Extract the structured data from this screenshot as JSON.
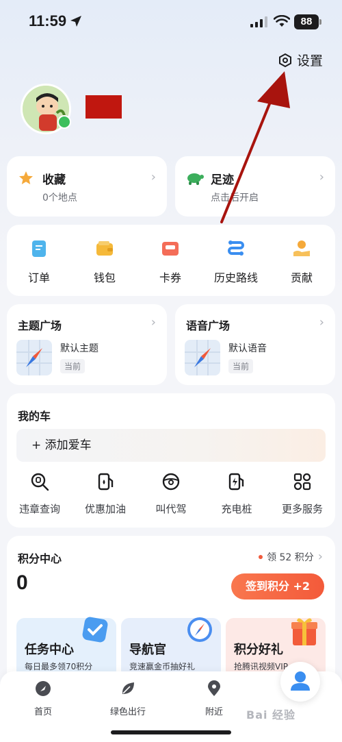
{
  "status": {
    "time": "11:59",
    "battery": "88"
  },
  "header": {
    "settings_label": "设置"
  },
  "favorites": {
    "title": "收藏",
    "subtitle": "0个地点"
  },
  "footprints": {
    "title": "足迹",
    "subtitle": "点击后开启"
  },
  "tools": [
    {
      "label": "订单",
      "icon": "order-icon"
    },
    {
      "label": "钱包",
      "icon": "wallet-icon"
    },
    {
      "label": "卡券",
      "icon": "coupon-icon"
    },
    {
      "label": "历史路线",
      "icon": "route-history-icon"
    },
    {
      "label": "贡献",
      "icon": "contribute-icon"
    }
  ],
  "theme_square": {
    "title": "主题广场",
    "name": "默认主题",
    "tag": "当前"
  },
  "voice_square": {
    "title": "语音广场",
    "name": "默认语音",
    "tag": "当前"
  },
  "my_car": {
    "title": "我的车",
    "add_label": "+ 添加爱车",
    "services": [
      {
        "label": "违章查询",
        "icon": "violation-search-icon"
      },
      {
        "label": "优惠加油",
        "icon": "fuel-icon"
      },
      {
        "label": "叫代驾",
        "icon": "steering-wheel-icon"
      },
      {
        "label": "充电桩",
        "icon": "charging-pile-icon"
      },
      {
        "label": "更多服务",
        "icon": "more-services-icon"
      }
    ]
  },
  "points": {
    "title": "积分中心",
    "value": "0",
    "claim_label": "领 52 积分",
    "signin_label": "签到积分 +2",
    "tiles": [
      {
        "title": "任务中心",
        "sub": "每日最多领70积分",
        "color": "#e4f0fc"
      },
      {
        "title": "导航官",
        "sub": "竞速赢金币抽好礼",
        "color": "#e6eefb"
      },
      {
        "title": "积分好礼",
        "sub": "抢腾讯视频VIP",
        "color": "#fde9e6"
      }
    ]
  },
  "tabbar": [
    {
      "label": "首页",
      "icon": "home-icon"
    },
    {
      "label": "绿色出行",
      "icon": "leaf-icon"
    },
    {
      "label": "附近",
      "icon": "location-pin-icon"
    }
  ],
  "watermark": "Bai 经验",
  "colors": {
    "accent": "#f35a3a",
    "annotation": "#c0170f",
    "tab_active": "#3a8ef0"
  }
}
